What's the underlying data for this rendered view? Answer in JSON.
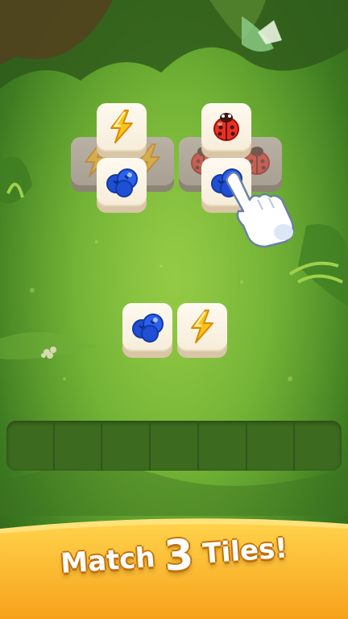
{
  "banner": {
    "word1": "Match",
    "number": "3",
    "word2": "Tiles!"
  },
  "tray": {
    "slot_count": 7
  },
  "colors": {
    "banner_orange": "#f7a21b",
    "banner_yellow": "#ffd24a",
    "tray_green": "#3c6a1f",
    "tile_cream": "#fffaf0"
  },
  "tiles": [
    {
      "id": "L-bottom-left",
      "icon": "lightning-icon",
      "layer": "bottom",
      "state": "covered"
    },
    {
      "id": "L-bottom-right",
      "icon": "lightning-icon",
      "layer": "bottom",
      "state": "covered"
    },
    {
      "id": "L-top",
      "icon": "lightning-icon",
      "layer": "top",
      "state": "free"
    },
    {
      "id": "L-mid",
      "icon": "blueberry-icon",
      "layer": "top",
      "state": "free"
    },
    {
      "id": "R-bottom-left",
      "icon": "ladybug-icon",
      "layer": "bottom",
      "state": "covered"
    },
    {
      "id": "R-bottom-right",
      "icon": "ladybug-icon",
      "layer": "bottom",
      "state": "covered"
    },
    {
      "id": "R-top",
      "icon": "ladybug-icon",
      "layer": "top",
      "state": "free"
    },
    {
      "id": "R-mid",
      "icon": "blueberry-icon",
      "layer": "top",
      "state": "free"
    },
    {
      "id": "C-left",
      "icon": "blueberry-icon",
      "layer": "top",
      "state": "free"
    },
    {
      "id": "C-right",
      "icon": "lightning-icon",
      "layer": "top",
      "state": "free"
    }
  ],
  "pointer": {
    "icon": "hand-pointer-icon"
  }
}
